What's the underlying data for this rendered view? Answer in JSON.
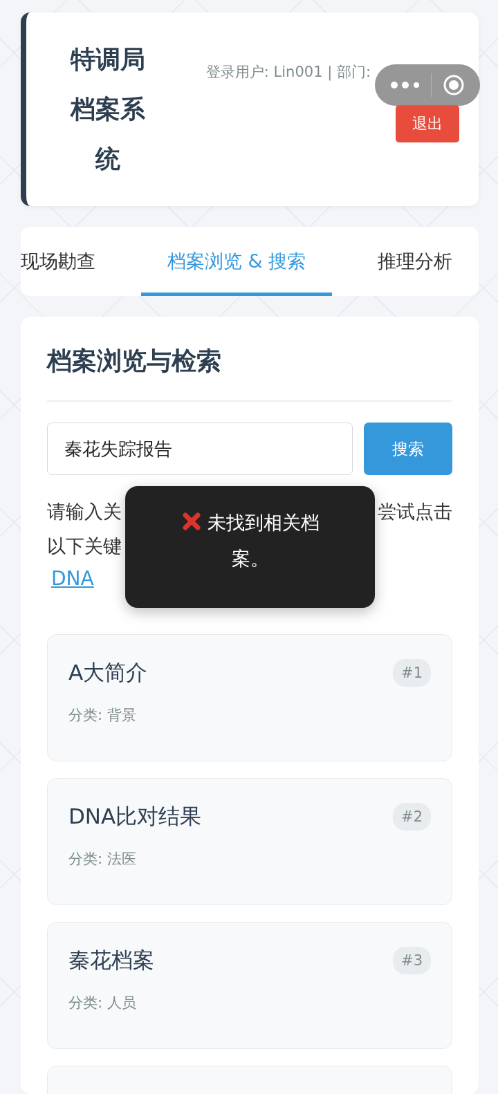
{
  "header": {
    "title": "特调局档案系统",
    "user_info": "登录用户: Lin001 | 部门:",
    "logout_button": "退出"
  },
  "tabs": [
    {
      "label": "现场勘查",
      "selected": false
    },
    {
      "label": "档案浏览 & 搜索",
      "selected": true
    },
    {
      "label": "推理分析",
      "selected": false
    }
  ],
  "panel": {
    "heading": "档案浏览与检索",
    "search": {
      "value": "秦花失踪报告",
      "button": "搜索"
    },
    "hint_fragments": [
      "请输入关",
      "尝试点击",
      "以下关键"
    ],
    "keywords": [
      "DNA"
    ]
  },
  "documents": [
    {
      "title": "A大简介",
      "category": "分类: 背景",
      "number": "#1"
    },
    {
      "title": "DNA比对结果",
      "category": "分类: 法医",
      "number": "#2"
    },
    {
      "title": "秦花档案",
      "category": "分类: 人员",
      "number": "#3"
    }
  ],
  "toast": {
    "kind": "error",
    "message": "未找到相关档案。"
  }
}
